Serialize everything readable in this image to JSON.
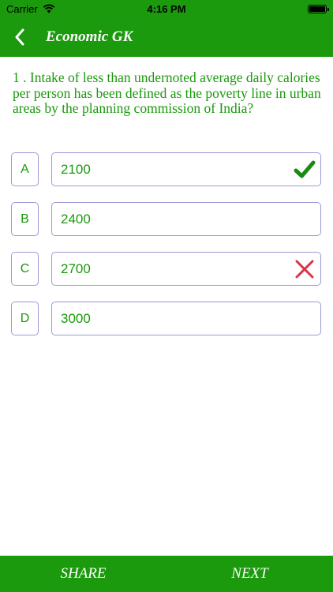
{
  "status_bar": {
    "carrier": "Carrier",
    "time": "4:16 PM",
    "battery_level": 1.0
  },
  "nav": {
    "title": "Economic GK",
    "back_icon": "chevron-left-icon"
  },
  "question": {
    "number": "1",
    "text": "1 . Intake of less than undernoted average daily calories per person has been defined as the poverty line in urban areas by the planning commission of India?"
  },
  "options": [
    {
      "letter": "A",
      "value": "2100",
      "mark": "correct",
      "mark_icon": "checkmark-icon",
      "mark_color": "#1a8a10"
    },
    {
      "letter": "B",
      "value": "2400",
      "mark": "",
      "mark_icon": "",
      "mark_color": ""
    },
    {
      "letter": "C",
      "value": "2700",
      "mark": "incorrect",
      "mark_icon": "cross-icon",
      "mark_color": "#d8344a"
    },
    {
      "letter": "D",
      "value": "3000",
      "mark": "",
      "mark_icon": "",
      "mark_color": ""
    }
  ],
  "footer": {
    "share_label": "SHARE",
    "next_label": "NEXT"
  },
  "colors": {
    "brand_green": "#1a9a0c",
    "option_border": "#9a9ad8",
    "correct": "#1a8a10",
    "incorrect": "#d8344a"
  }
}
